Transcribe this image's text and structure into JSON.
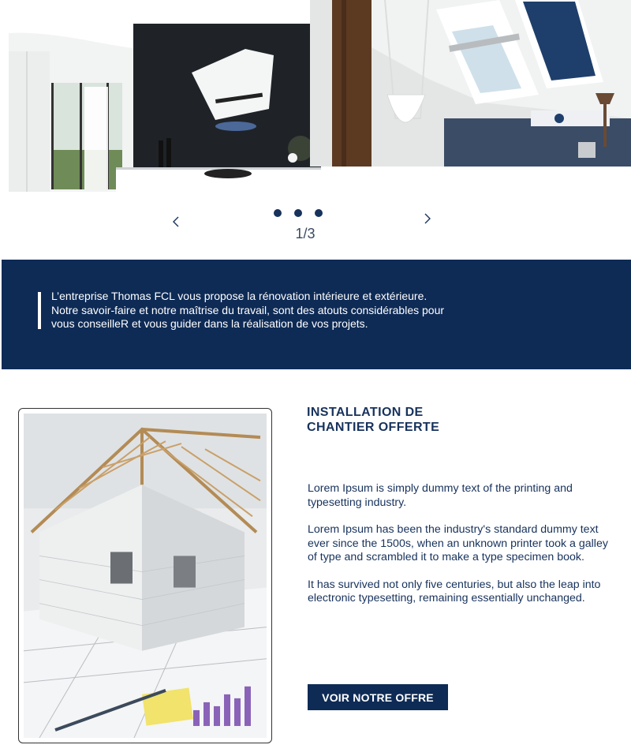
{
  "slider": {
    "counter": "1/3",
    "dots_count": 3,
    "prev_icon": "chevron-left-icon",
    "next_icon": "chevron-right-icon"
  },
  "intro": {
    "lines": [
      "L’entreprise Thomas FCL vous propose la rénovation intérieure et extérieure.",
      "Notre savoir-faire et notre maîtrise du travail, sont des atouts considérables pour",
      "vous conseilleR et vous guider dans la réalisation de vos projets."
    ]
  },
  "offer": {
    "title_lines": [
      "INSTALLATION DE",
      "CHANTIER OFFERTE"
    ],
    "paragraphs": [
      "Lorem Ipsum is simply dummy text of the printing and typesetting industry.",
      "Lorem Ipsum has been the industry's standard dummy text ever since the 1500s, when an unknown printer took a galley of type and scrambled it to make a type specimen book.",
      "It has survived not only five centuries, but also the leap into electronic typesetting, remaining essentially unchanged."
    ],
    "button_label": "VOIR NOTRE OFFRE"
  },
  "colors": {
    "brand_navy": "#0e2b56",
    "text_navy": "#17325c",
    "white": "#ffffff"
  }
}
